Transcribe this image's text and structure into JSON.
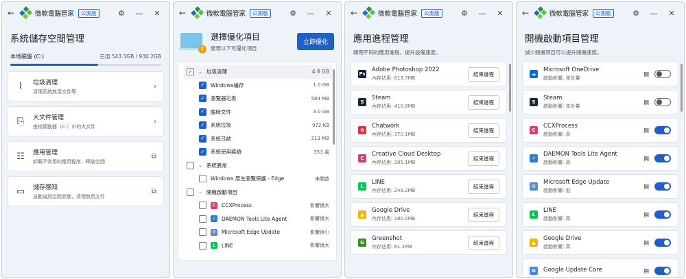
{
  "app": {
    "title": "微軟電腦管家",
    "badge": "公測版"
  },
  "colors": {
    "accent": "#1e5fc9",
    "panel": "#eef3f9"
  },
  "storage": {
    "title": "系統儲存空間管理",
    "disk_label": "本地磁盤 (C:)",
    "disk_usage": "已用 543.3GB / 930.2GB",
    "used_fraction": 0.584,
    "items": [
      {
        "title": "垃圾清理",
        "desc": "清理系統無用文件等",
        "icon": "broom-icon",
        "action": "chevron"
      },
      {
        "title": "大文件管理",
        "desc": "查找驅動器（C:）中的大文件",
        "icon": "file-search-icon",
        "action": "chevron"
      },
      {
        "title": "應用管理",
        "desc": "卸載不常用的應用程序，釋放空間",
        "icon": "apps-icon",
        "action": "external"
      },
      {
        "title": "儲存感知",
        "desc": "自動識別空間狀態，清理無用文件",
        "icon": "storage-sense-icon",
        "action": "external"
      }
    ]
  },
  "optimize": {
    "title": "選擇優化項目",
    "subtitle": "發現以下可優化項目",
    "button": "立即優化",
    "groups": [
      {
        "label": "垃圾清理",
        "size": "4.8 GB",
        "checked": true,
        "items": [
          {
            "label": "Windows緩存",
            "value": "1.0 GB",
            "checked": true
          },
          {
            "label": "瀏覽器垃圾",
            "value": "584 MB",
            "checked": true
          },
          {
            "label": "臨時文件",
            "value": "3.0 GB",
            "checked": true
          },
          {
            "label": "系統垃圾",
            "value": "972 KB",
            "checked": true
          },
          {
            "label": "系統日誌",
            "value": "213 MB",
            "checked": true
          },
          {
            "label": "系統使用痕跡",
            "value": "353 處",
            "checked": true
          }
        ]
      },
      {
        "label": "系統異常",
        "size": "",
        "checked": false,
        "items": [
          {
            "label": "Windows 原生瀏覽保護 - Edge",
            "value": "未開啟",
            "checked": false
          }
        ]
      },
      {
        "label": "開機啟動項目",
        "size": "",
        "checked": false,
        "items": [
          {
            "label": "CCXProcess",
            "value": "影響很大",
            "checked": false,
            "icon": "ccx-icon"
          },
          {
            "label": "DAEMON Tools Lite Agent",
            "value": "影響很大",
            "checked": false,
            "icon": "daemon-icon"
          },
          {
            "label": "Microsoft Edge Update",
            "value": "影響很小",
            "checked": false,
            "icon": "edge-update-icon"
          },
          {
            "label": "LINE",
            "value": "影響很大",
            "checked": false,
            "icon": "line-icon"
          }
        ]
      }
    ]
  },
  "process": {
    "title": "應用進程管理",
    "subtitle": "關閉不同的應用進程，提升設備速度。",
    "end_label": "結束進程",
    "items": [
      {
        "name": "Adobe Photoshop 2022",
        "mem": "內存佔用: 613.7MB",
        "icon": "photoshop-icon",
        "color": "#0d1a3a",
        "glyph": "Ps"
      },
      {
        "name": "Steam",
        "mem": "內存佔用: 410.8MB",
        "icon": "steam-icon",
        "color": "#1b2838",
        "glyph": "S"
      },
      {
        "name": "Chatwork",
        "mem": "內存佔用: 370.1MB",
        "icon": "chatwork-icon",
        "color": "#e0323c",
        "glyph": "✿"
      },
      {
        "name": "Creative Cloud Desktop",
        "mem": "內存佔用: 285.1MB",
        "icon": "creative-cloud-icon",
        "color": "#d63b7a",
        "glyph": "C"
      },
      {
        "name": "LINE",
        "mem": "內存佔用: 248.2MB",
        "icon": "line-icon",
        "color": "#06c755",
        "glyph": "L"
      },
      {
        "name": "Google Drive",
        "mem": "內存佔用: 180.0MB",
        "icon": "google-drive-icon",
        "color": "#f5b400",
        "glyph": "▲"
      },
      {
        "name": "Greenshot",
        "mem": "內存佔用: 61.2MB",
        "icon": "greenshot-icon",
        "color": "#3a8a2a",
        "glyph": "G"
      }
    ]
  },
  "startup": {
    "title": "開機啟動項目管理",
    "subtitle": "減少開機項目可以提升開機速度。",
    "items": [
      {
        "name": "Microsoft OneDrive",
        "impact": "啟動影響: 未計量",
        "state": "關",
        "on": false,
        "icon": "onedrive-icon",
        "color": "#0b6fd1",
        "glyph": "☁"
      },
      {
        "name": "Steam",
        "impact": "啟動影響: 未計量",
        "state": "關",
        "on": false,
        "icon": "steam-icon",
        "color": "#1b2838",
        "glyph": "S"
      },
      {
        "name": "CCXProcess",
        "impact": "啟動影響: 高",
        "state": "開",
        "on": true,
        "icon": "ccx-icon",
        "color": "#d63b7a",
        "glyph": "C"
      },
      {
        "name": "DAEMON Tools Lite Agent",
        "impact": "啟動影響: 高",
        "state": "開",
        "on": true,
        "icon": "daemon-icon",
        "color": "#2a7fd4",
        "glyph": "⚡"
      },
      {
        "name": "Microsoft Edge Update",
        "impact": "啟動影響: 低",
        "state": "開",
        "on": true,
        "icon": "edge-update-icon",
        "color": "#5a8ac8",
        "glyph": "⚙"
      },
      {
        "name": "LINE",
        "impact": "啟動影響: 高",
        "state": "開",
        "on": true,
        "icon": "line-icon",
        "color": "#06c755",
        "glyph": "L"
      },
      {
        "name": "Google Drive",
        "impact": "啟動影響: 高",
        "state": "開",
        "on": true,
        "icon": "google-drive-icon",
        "color": "#f5b400",
        "glyph": "▲"
      },
      {
        "name": "Google Update Core",
        "impact": "",
        "state": "開",
        "on": true,
        "icon": "google-update-icon",
        "color": "#4285f4",
        "glyph": "G"
      }
    ]
  }
}
